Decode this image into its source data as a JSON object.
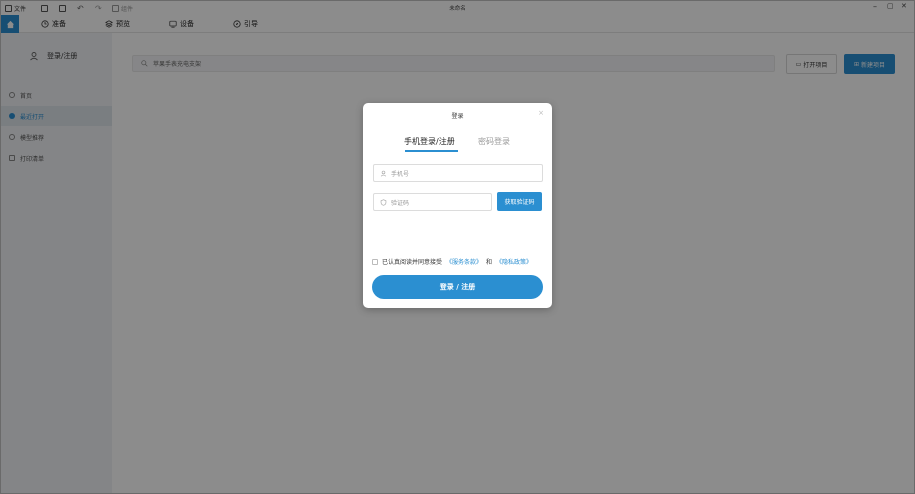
{
  "titlebar": {
    "file_label": "文件",
    "layout_label": "组件",
    "window_title": "未命名",
    "minimize": "–",
    "restore": "▢",
    "close": "✕"
  },
  "menubar": {
    "items": [
      {
        "label": "准备",
        "icon": "clock-icon"
      },
      {
        "label": "预览",
        "icon": "layers-icon"
      },
      {
        "label": "设备",
        "icon": "device-icon"
      },
      {
        "label": "引导",
        "icon": "compass-icon"
      }
    ]
  },
  "sidebar": {
    "login_label": "登录/注册",
    "items": [
      {
        "label": "首页",
        "active": false
      },
      {
        "label": "最近打开",
        "active": true
      },
      {
        "label": "模型推荐",
        "active": false
      },
      {
        "label": "打印清单",
        "active": false
      }
    ]
  },
  "main": {
    "search_placeholder": "苹果手表充电支架",
    "open_project_label": "打开项目",
    "new_project_label": "新建项目"
  },
  "login_modal": {
    "title": "登录",
    "close_icon": "×",
    "tab_phone": "手机登录/注册",
    "tab_password": "密码登录",
    "phone_placeholder": "手机号",
    "code_placeholder": "验证码",
    "get_code_label": "获取验证码",
    "agree_text": "已认真阅读并同意接受",
    "terms_link": "《服务条款》",
    "and_text": "和",
    "privacy_link": "《隐私政策》",
    "submit_label": "登录 / 注册"
  },
  "colors": {
    "accent": "#2b8fd1",
    "overlay": "rgba(0,0,0,0.45)"
  }
}
